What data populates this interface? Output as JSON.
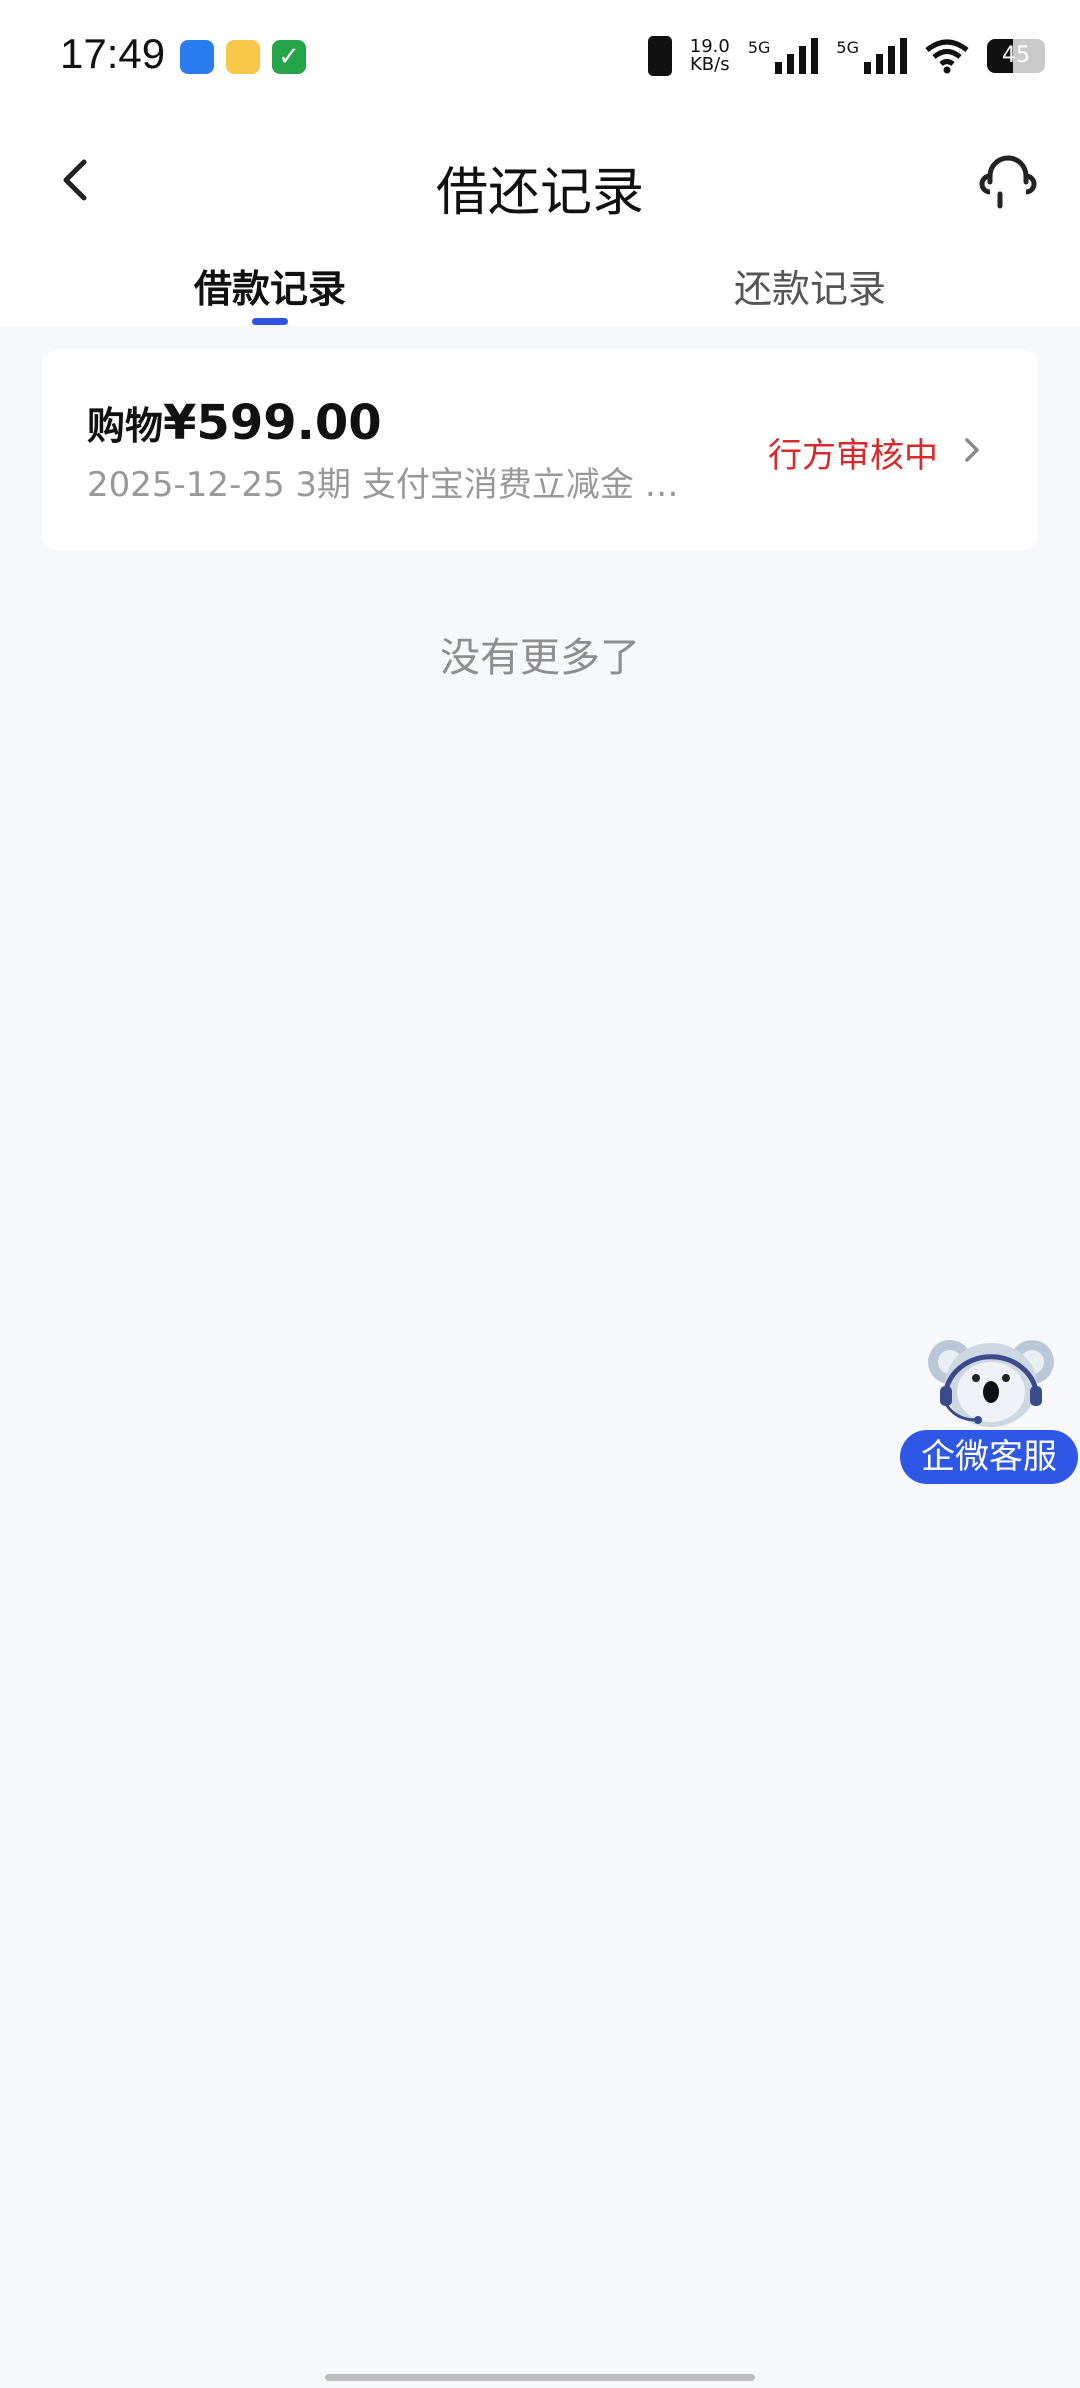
{
  "status_bar": {
    "time": "17:49",
    "net_speed_value": "19.0",
    "net_speed_unit": "KB/s",
    "sim1_tag": "5G",
    "sim2_tag": "5G",
    "battery": "45"
  },
  "nav": {
    "title": "借还记录"
  },
  "tabs": [
    {
      "label": "借款记录",
      "active": true
    },
    {
      "label": "还款记录",
      "active": false
    }
  ],
  "records": [
    {
      "category": "购物",
      "amount": "¥599.00",
      "subtitle": "2025-12-25 3期  支付宝消费立减金 …",
      "status": "行方审核中"
    }
  ],
  "list_end_text": "没有更多了",
  "floating_service": {
    "label": "企微客服"
  },
  "colors": {
    "accent": "#2d53e0",
    "status_red": "#d82a2a",
    "background": "#f7f8fc"
  }
}
